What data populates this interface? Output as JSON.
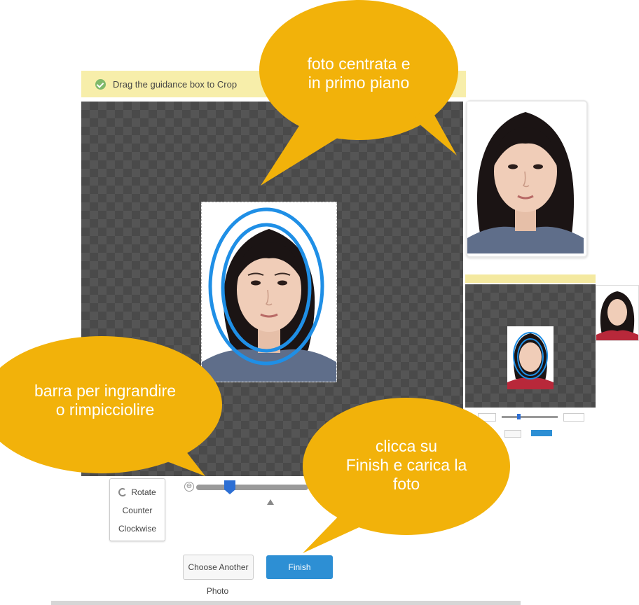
{
  "guidance": {
    "text": "Drag the guidance box to Crop"
  },
  "controls": {
    "rotate_line1": "Rotate",
    "rotate_line2": "Counter",
    "rotate_line3": "Clockwise",
    "zoom_minus": "⊖",
    "zoom_level_fraction": 0.3,
    "choose_line1": "Choose Another",
    "choose_line2": "Photo",
    "finish_label": "Finish"
  },
  "annotations": {
    "bubble_top_line1": "foto centrata e",
    "bubble_top_line2": "in primo piano",
    "bubble_left_line1": "barra per ingrandire",
    "bubble_left_line2": "o rimpicciolire",
    "bubble_right_line1": "clicca su",
    "bubble_right_line2": "Finish e carica la",
    "bubble_right_line3": "foto"
  },
  "colors": {
    "bubble": "#f2b20a",
    "guide_oval": "#1f8fe6",
    "finish_button": "#2d8fd4",
    "guidance_bar": "#f7eeaa"
  },
  "icons": {
    "rotate": "rotate-counter-clockwise-icon",
    "check": "check-circle-icon",
    "zoom_out": "zoom-out-icon",
    "slider": "slider-thumb-icon",
    "reset": "triangle-up-icon"
  }
}
